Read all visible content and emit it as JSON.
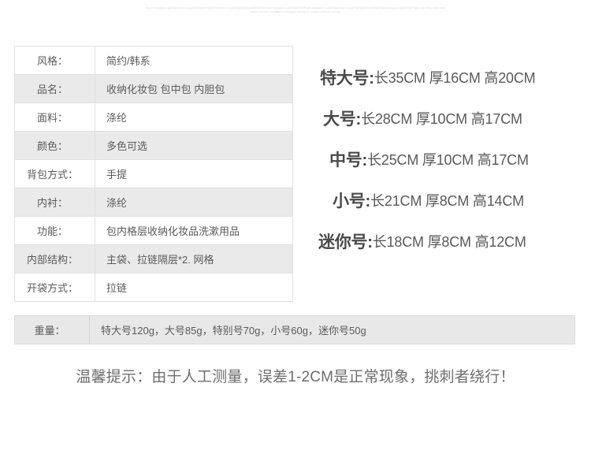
{
  "micro_header": {
    "line1": "Product Information is good opportunity to present and orient Product Information is a good opportunity to orientPrevious Product Information is good opportunity Product Information is a good opportunity to present and orient most different Keyboard resource present input matter most different other brand",
    "line2": "present and orient most different to the level of transparency software to the least of reason"
  },
  "spec_table": {
    "rows": [
      {
        "key": "风格：",
        "value": "简约/韩系",
        "shaded": false
      },
      {
        "key": "品名：",
        "value": "收纳化妆包  包中包  内胆包",
        "shaded": true
      },
      {
        "key": "面料：",
        "value": "涤纶",
        "shaded": false
      },
      {
        "key": "颜色：",
        "value": "多色可选",
        "shaded": true
      },
      {
        "key": "背包方式：",
        "value": "手提",
        "shaded": false
      },
      {
        "key": "内衬：",
        "value": "涤纶",
        "shaded": true
      },
      {
        "key": "功能：",
        "value": "包内格层收纳化妆品洗漱用品",
        "shaded": false
      },
      {
        "key": "内部结构：",
        "value": "主袋、拉链隔层*2. 网格",
        "shaded": true
      },
      {
        "key": "开袋方式：",
        "value": "拉链",
        "shaded": false
      }
    ]
  },
  "weight_row": {
    "key": "重量：",
    "value": "特大号120g，大号85g，特别号70g，小号60g，迷你号50g"
  },
  "sizes": [
    {
      "label": "特大号:",
      "dims": "长35CM 厚16CM 高20CM"
    },
    {
      "label": "大号:",
      "dims": "长28CM 厚10CM 高17CM"
    },
    {
      "label": "中号:",
      "dims": "长25CM 厚10CM 高17CM"
    },
    {
      "label": "小号:",
      "dims": "长21CM 厚8CM 高14CM"
    },
    {
      "label": "迷你号:",
      "dims": "长18CM 厚8CM 高12CM"
    }
  ],
  "notice": {
    "text": "温馨提示：由于人工测量，误差1-2CM是正常现象，挑刺者绕行！"
  },
  "colors": {
    "shaded_row": "#eaeaea",
    "weight_band": "#e8e8e8",
    "border": "#e0e0e0",
    "text": "#5a5a5a",
    "notice_text": "#6e6e6e"
  }
}
